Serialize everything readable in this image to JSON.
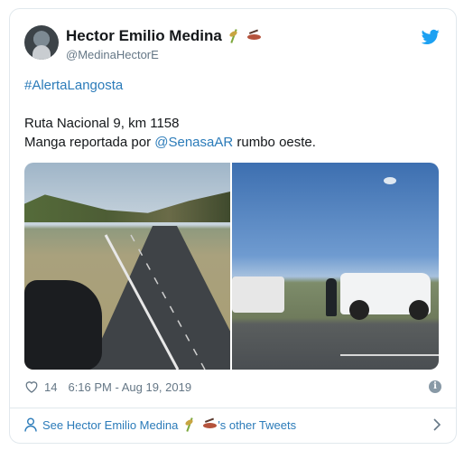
{
  "tweet": {
    "author_name": "Hector Emilio Medina",
    "author_handle": "@MedinaHectorE",
    "hashtag": "#AlertaLangosta",
    "line1": "Ruta Nacional  9, km 1158",
    "line2_prefix": "Manga reportada por ",
    "line2_mention": "@SenasaAR",
    "line2_suffix": " rumbo oeste.",
    "likes": "14",
    "timestamp": "6:16 PM - Aug 19, 2019",
    "info_glyph": "i",
    "icons": [
      "twitter-bird-icon",
      "sheaf-of-rice-icon",
      "cricket-icon",
      "heart-icon",
      "info-icon",
      "person-icon",
      "chevron-right-icon"
    ]
  },
  "footer": {
    "prefix": "See ",
    "name": "Hector Emilio Medina",
    "suffix": "'s other Tweets"
  },
  "colors": {
    "link": "#2b7bb9",
    "muted": "#657786",
    "twitter_blue": "#1da1f2",
    "border": "#e1e8ed"
  }
}
